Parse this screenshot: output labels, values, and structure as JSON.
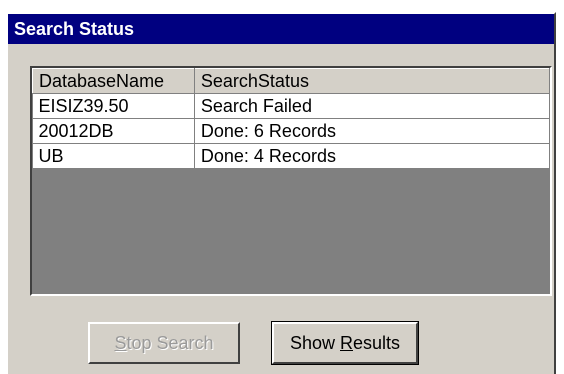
{
  "window": {
    "title": "Search Status"
  },
  "grid": {
    "columns": [
      "DatabaseName",
      "SearchStatus"
    ],
    "rows": [
      [
        "EISIZ39.50",
        "Search Failed"
      ],
      [
        "20012DB",
        "Done: 6 Records"
      ],
      [
        "UB",
        "Done: 4 Records"
      ]
    ]
  },
  "buttons": {
    "stop": {
      "label_hot": "S",
      "label_rest": "top Search",
      "enabled": false
    },
    "show": {
      "label_pre": "Show ",
      "label_hot": "R",
      "label_rest": "esults",
      "enabled": true
    }
  }
}
